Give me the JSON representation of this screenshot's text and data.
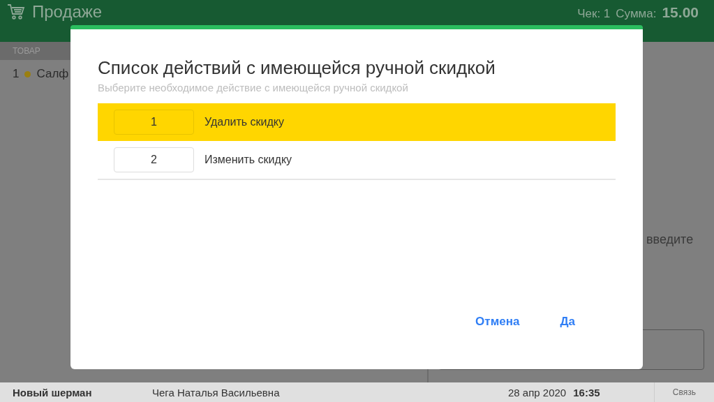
{
  "header": {
    "title": "Продаже",
    "receipt": "Чек: 1",
    "sum_label": "Сумма:",
    "sum_value": "15.00"
  },
  "table": {
    "column_1": "ТОВАР",
    "rows": [
      {
        "number": "1",
        "name": "Салф"
      }
    ]
  },
  "right_panel": {
    "hint": "введите"
  },
  "dialog": {
    "title": "Список действий с имеющейся ручной скидкой",
    "subtitle": "Выберите необходимое действие с имеющейся ручной скидкой",
    "actions": [
      {
        "number": "1",
        "label": "Удалить скидку",
        "selected": true
      },
      {
        "number": "2",
        "label": "Изменить скидку",
        "selected": false
      }
    ],
    "buttons": [
      {
        "label": "Отмена"
      },
      {
        "label": "Да"
      }
    ]
  },
  "status_bar": {
    "shift": "Новый шерман",
    "cashier": "Чега Наталья Васильевна",
    "date": "28 апр 2020",
    "time": "16:35",
    "connection": "Связь"
  }
}
